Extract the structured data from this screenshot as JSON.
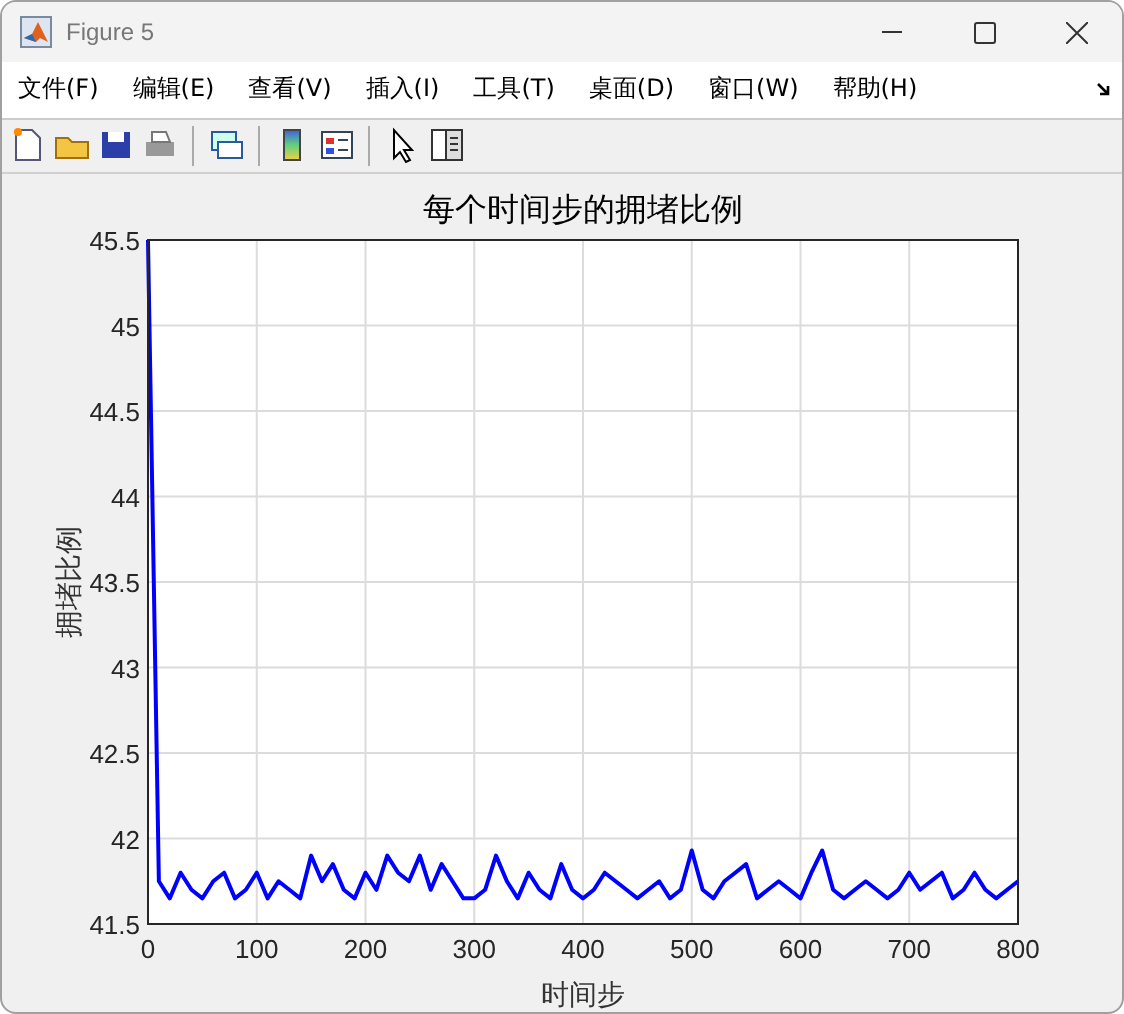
{
  "window": {
    "title": "Figure 5"
  },
  "menu": [
    "文件(F)",
    "编辑(E)",
    "查看(V)",
    "插入(I)",
    "工具(T)",
    "桌面(D)",
    "窗口(W)",
    "帮助(H)"
  ],
  "toolbar": [
    {
      "kind": "new"
    },
    {
      "kind": "open"
    },
    {
      "kind": "save"
    },
    {
      "kind": "print"
    },
    {
      "kind": "sep"
    },
    {
      "kind": "link"
    },
    {
      "kind": "sep"
    },
    {
      "kind": "colorbar"
    },
    {
      "kind": "legend"
    },
    {
      "kind": "sep"
    },
    {
      "kind": "pointer"
    },
    {
      "kind": "panel"
    }
  ],
  "axes": {
    "chart_data": {
      "type": "line",
      "title": "每个时间步的拥堵比例",
      "xlabel": "时间步",
      "ylabel": "拥堵比例",
      "xlim": [
        0,
        800
      ],
      "ylim": [
        41.5,
        45.5
      ],
      "xticks": [
        0,
        100,
        200,
        300,
        400,
        500,
        600,
        700,
        800
      ],
      "yticks": [
        {
          "value": 41.5,
          "label": "41.5"
        },
        {
          "value": 42,
          "label": "42"
        },
        {
          "value": 42.5,
          "label": "42.5"
        },
        {
          "value": 43,
          "label": "43"
        },
        {
          "value": 43.5,
          "label": "43.5"
        },
        {
          "value": 44,
          "label": "44"
        },
        {
          "value": 44.5,
          "label": "44.5"
        },
        {
          "value": 45,
          "label": "45"
        },
        {
          "value": 45.5,
          "label": "45.5"
        }
      ],
      "x": [
        0,
        10,
        20,
        30,
        40,
        50,
        60,
        70,
        80,
        90,
        100,
        110,
        120,
        130,
        140,
        150,
        160,
        170,
        180,
        190,
        200,
        210,
        220,
        230,
        240,
        250,
        260,
        270,
        280,
        290,
        300,
        310,
        320,
        330,
        340,
        350,
        360,
        370,
        380,
        390,
        400,
        410,
        420,
        430,
        440,
        450,
        460,
        470,
        480,
        490,
        500,
        510,
        520,
        530,
        540,
        550,
        560,
        570,
        580,
        590,
        600,
        610,
        620,
        630,
        640,
        650,
        660,
        670,
        680,
        690,
        700,
        710,
        720,
        730,
        740,
        750,
        760,
        770,
        780,
        790,
        800
      ],
      "grid": true,
      "series": [
        {
          "color": "#0000ff",
          "values": [
            45.5,
            41.75,
            41.65,
            41.8,
            41.7,
            41.65,
            41.75,
            41.8,
            41.65,
            41.7,
            41.8,
            41.65,
            41.75,
            41.7,
            41.65,
            41.9,
            41.75,
            41.85,
            41.7,
            41.65,
            41.8,
            41.7,
            41.9,
            41.8,
            41.75,
            41.9,
            41.7,
            41.85,
            41.75,
            41.65,
            41.65,
            41.7,
            41.9,
            41.75,
            41.65,
            41.8,
            41.7,
            41.65,
            41.85,
            41.7,
            41.65,
            41.7,
            41.8,
            41.75,
            41.7,
            41.65,
            41.7,
            41.75,
            41.65,
            41.7,
            41.93,
            41.7,
            41.65,
            41.75,
            41.8,
            41.85,
            41.65,
            41.7,
            41.75,
            41.7,
            41.65,
            41.8,
            41.93,
            41.7,
            41.65,
            41.7,
            41.75,
            41.7,
            41.65,
            41.7,
            41.8,
            41.7,
            41.75,
            41.8,
            41.65,
            41.7,
            41.8,
            41.7,
            41.65,
            41.7,
            41.75
          ]
        }
      ]
    }
  }
}
